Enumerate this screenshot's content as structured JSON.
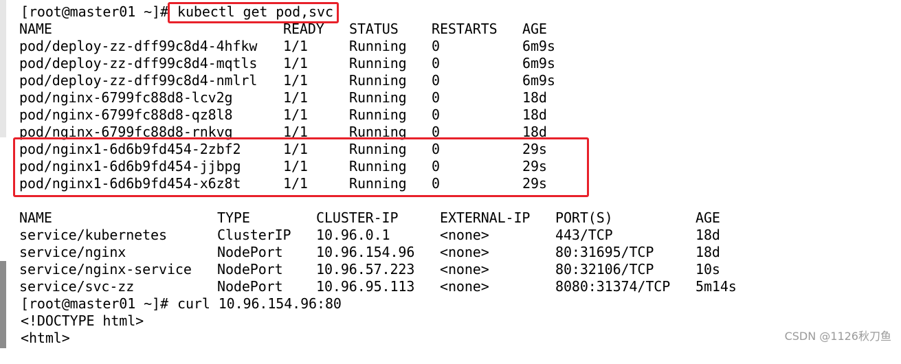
{
  "terminal": {
    "prompt": "[root@master01 ~]#",
    "command1": "kubectl get pod,svc",
    "command2": "curl 10.96.154.96:80",
    "pods_header": [
      "NAME",
      "READY",
      "STATUS",
      "RESTARTS",
      "AGE"
    ],
    "pods": [
      [
        "pod/deploy-zz-dff99c8d4-4hfkw",
        "1/1",
        "Running",
        "0",
        "6m9s"
      ],
      [
        "pod/deploy-zz-dff99c8d4-mqtls",
        "1/1",
        "Running",
        "0",
        "6m9s"
      ],
      [
        "pod/deploy-zz-dff99c8d4-nmlrl",
        "1/1",
        "Running",
        "0",
        "6m9s"
      ],
      [
        "pod/nginx-6799fc88d8-lcv2g",
        "1/1",
        "Running",
        "0",
        "18d"
      ],
      [
        "pod/nginx-6799fc88d8-qz8l8",
        "1/1",
        "Running",
        "0",
        "18d"
      ],
      [
        "pod/nginx-6799fc88d8-rnkvg",
        "1/1",
        "Running",
        "0",
        "18d"
      ],
      [
        "pod/nginx1-6d6b9fd454-2zbf2",
        "1/1",
        "Running",
        "0",
        "29s"
      ],
      [
        "pod/nginx1-6d6b9fd454-jjbpg",
        "1/1",
        "Running",
        "0",
        "29s"
      ],
      [
        "pod/nginx1-6d6b9fd454-x6z8t",
        "1/1",
        "Running",
        "0",
        "29s"
      ]
    ],
    "svc_header": [
      "NAME",
      "TYPE",
      "CLUSTER-IP",
      "EXTERNAL-IP",
      "PORT(S)",
      "AGE"
    ],
    "services": [
      [
        "service/kubernetes",
        "ClusterIP",
        "10.96.0.1",
        "<none>",
        "443/TCP",
        "18d"
      ],
      [
        "service/nginx",
        "NodePort",
        "10.96.154.96",
        "<none>",
        "80:31695/TCP",
        "18d"
      ],
      [
        "service/nginx-service",
        "NodePort",
        "10.96.57.223",
        "<none>",
        "80:32106/TCP",
        "10s"
      ],
      [
        "service/svc-zz",
        "NodePort",
        "10.96.95.113",
        "<none>",
        "8080:31374/TCP",
        "5m14s"
      ]
    ],
    "output_lines": [
      "<!DOCTYPE html>",
      "<html>"
    ]
  },
  "watermark": "CSDN @1126秋刀鱼",
  "colors": {
    "highlight_box": "#e8212a",
    "background": "#ffffff",
    "text": "#000000"
  }
}
